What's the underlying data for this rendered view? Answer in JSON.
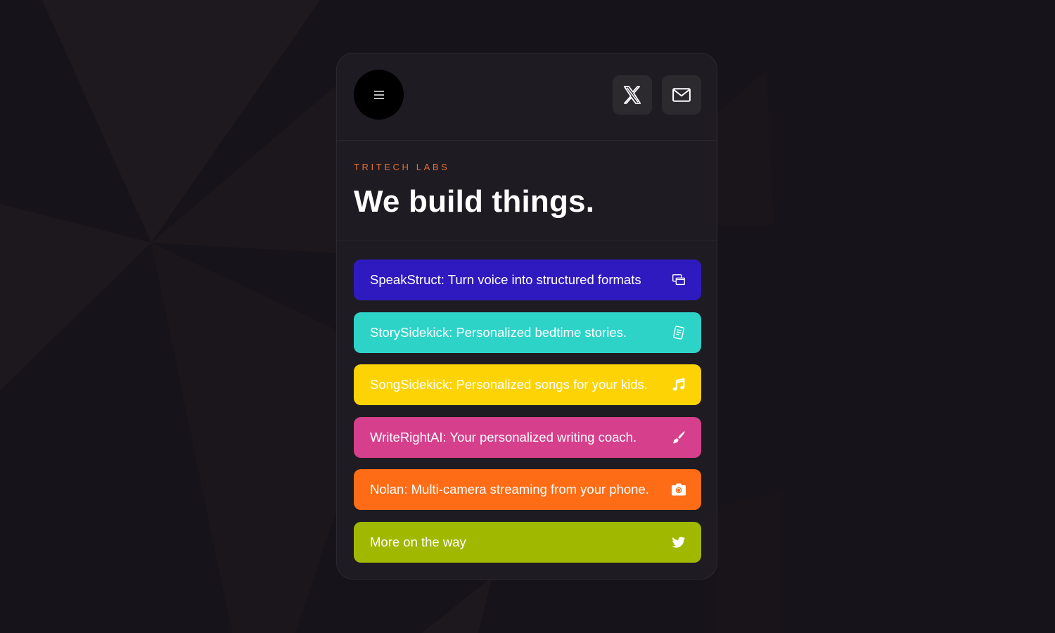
{
  "header": {
    "menu_icon": "hamburger-menu-icon",
    "social": [
      {
        "name": "x-twitter",
        "icon": "x-logo-icon"
      },
      {
        "name": "email",
        "icon": "mail-icon"
      }
    ]
  },
  "hero": {
    "eyebrow": "TRITECH LABS",
    "title": "We build things."
  },
  "products": [
    {
      "label": "SpeakStruct: Turn voice into structured formats",
      "icon": "windows-stack-icon",
      "color": "#2f1ac0"
    },
    {
      "label": "StorySidekick: Personalized bedtime stories.",
      "icon": "document-icon",
      "color": "#2ed3c8"
    },
    {
      "label": "SongSidekick: Personalized songs for your kids.",
      "icon": "music-note-icon",
      "color": "#fdd305"
    },
    {
      "label": "WriteRightAI: Your personalized writing coach.",
      "icon": "paintbrush-icon",
      "color": "#d63f8c"
    },
    {
      "label": "Nolan: Multi-camera streaming from your phone.",
      "icon": "camera-icon",
      "color": "#fe6c16"
    },
    {
      "label": "More on the way",
      "icon": "twitter-bird-icon",
      "color": "#a1b800"
    }
  ],
  "colors": {
    "background": "#17131a",
    "panel": "#1f1b22",
    "accent": "#e0703a"
  }
}
